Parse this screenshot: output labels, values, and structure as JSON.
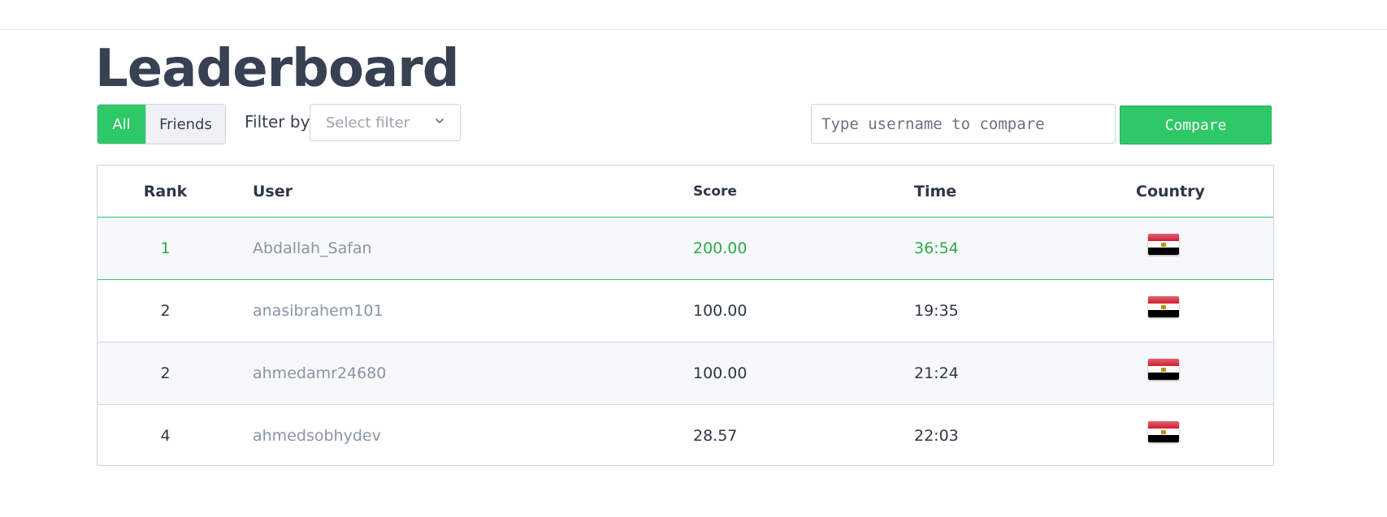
{
  "title": "Leaderboard",
  "toggle": {
    "all_label": "All",
    "friends_label": "Friends",
    "active": "All"
  },
  "filter": {
    "label": "Filter by",
    "placeholder": "Select filter"
  },
  "compare": {
    "placeholder": "Type username to compare",
    "button_label": "Compare"
  },
  "table": {
    "headers": {
      "rank": "Rank",
      "user": "User",
      "score": "Score",
      "time": "Time",
      "country": "Country"
    },
    "rows": [
      {
        "rank": "1",
        "user": "Abdallah_Safan",
        "score": "200.00",
        "time": "36:54",
        "country": "egypt-flag-icon"
      },
      {
        "rank": "2",
        "user": "anasibrahem101",
        "score": "100.00",
        "time": "19:35",
        "country": "egypt-flag-icon"
      },
      {
        "rank": "2",
        "user": "ahmedamr24680",
        "score": "100.00",
        "time": "21:24",
        "country": "egypt-flag-icon"
      },
      {
        "rank": "4",
        "user": "ahmedsobhydev",
        "score": "28.57",
        "time": "22:03",
        "country": "egypt-flag-icon"
      }
    ]
  },
  "colors": {
    "accent": "#2ec866",
    "highlight_text": "#2ea84d"
  }
}
